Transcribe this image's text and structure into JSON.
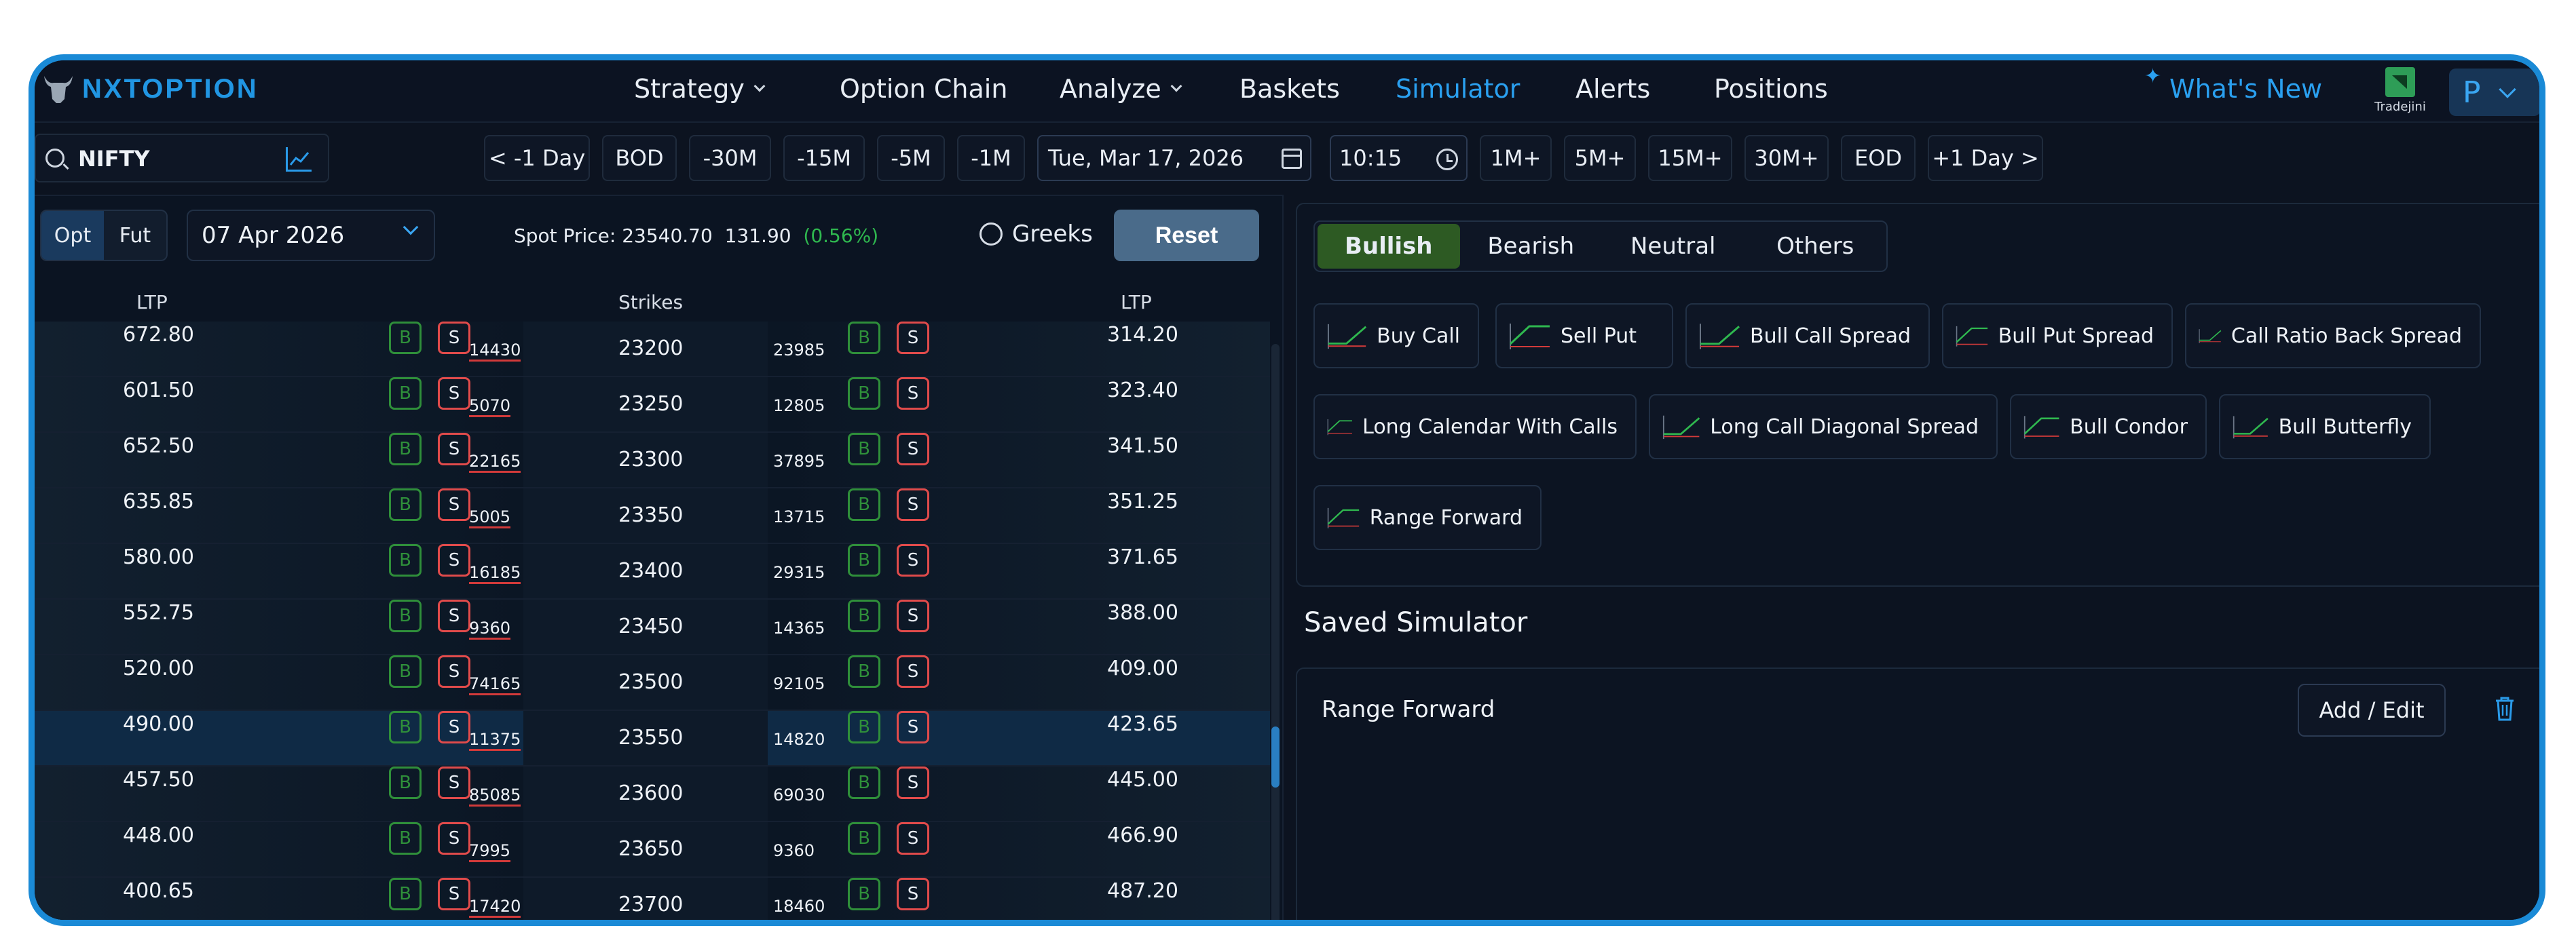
{
  "brand": "NXTOPTION",
  "nav": {
    "items": [
      {
        "label": "Strategy",
        "dropdown": true
      },
      {
        "label": "Option Chain",
        "dropdown": false
      },
      {
        "label": "Analyze",
        "dropdown": true
      },
      {
        "label": "Baskets",
        "dropdown": false
      },
      {
        "label": "Simulator",
        "dropdown": false,
        "active": true
      },
      {
        "label": "Alerts",
        "dropdown": false
      },
      {
        "label": "Positions",
        "dropdown": false
      }
    ],
    "whats_new": "What's New",
    "broker": "Tradejini",
    "profile_initial": "P"
  },
  "search": {
    "value": "NIFTY"
  },
  "toolbar": {
    "buttons": [
      "< -1 Day",
      "BOD",
      "-30M",
      "-15M",
      "-5M",
      "-1M"
    ],
    "date": "Tue, Mar 17, 2026",
    "time": "10:15",
    "buttons_after": [
      "1M+",
      "5M+",
      "15M+",
      "30M+",
      "EOD",
      "+1 Day >"
    ]
  },
  "chain": {
    "segments": [
      "Opt",
      "Fut"
    ],
    "active_segment": "Opt",
    "expiry": "07 Apr 2026",
    "spot_label": "Spot Price: 23540.70",
    "spot_change": "131.90",
    "spot_change_pct": "(0.56%)",
    "greeks_label": "Greeks",
    "reset_label": "Reset",
    "headers": {
      "ltp_left": "LTP",
      "strikes": "Strikes",
      "ltp_right": "LTP"
    },
    "buy_label": "B",
    "sell_label": "S",
    "rows": [
      {
        "call_ltp": "672.80",
        "call_oi": "14430",
        "strike": "23200",
        "put_oi": "23985",
        "put_ltp": "314.20"
      },
      {
        "call_ltp": "601.50",
        "call_oi": "5070",
        "strike": "23250",
        "put_oi": "12805",
        "put_ltp": "323.40"
      },
      {
        "call_ltp": "652.50",
        "call_oi": "22165",
        "strike": "23300",
        "put_oi": "37895",
        "put_ltp": "341.50"
      },
      {
        "call_ltp": "635.85",
        "call_oi": "5005",
        "strike": "23350",
        "put_oi": "13715",
        "put_ltp": "351.25"
      },
      {
        "call_ltp": "580.00",
        "call_oi": "16185",
        "strike": "23400",
        "put_oi": "29315",
        "put_ltp": "371.65"
      },
      {
        "call_ltp": "552.75",
        "call_oi": "9360",
        "strike": "23450",
        "put_oi": "14365",
        "put_ltp": "388.00"
      },
      {
        "call_ltp": "520.00",
        "call_oi": "74165",
        "strike": "23500",
        "put_oi": "92105",
        "put_ltp": "409.00"
      },
      {
        "call_ltp": "490.00",
        "call_oi": "11375",
        "strike": "23550",
        "put_oi": "14820",
        "put_ltp": "423.65",
        "atm": true
      },
      {
        "call_ltp": "457.50",
        "call_oi": "85085",
        "strike": "23600",
        "put_oi": "69030",
        "put_ltp": "445.00"
      },
      {
        "call_ltp": "448.00",
        "call_oi": "7995",
        "strike": "23650",
        "put_oi": "9360",
        "put_ltp": "466.90"
      },
      {
        "call_ltp": "400.65",
        "call_oi": "17420",
        "strike": "23700",
        "put_oi": "18460",
        "put_ltp": "487.20"
      }
    ]
  },
  "strategies": {
    "tabs": [
      "Bullish",
      "Bearish",
      "Neutral",
      "Others"
    ],
    "active_tab": "Bullish",
    "items": [
      "Buy Call",
      "Sell Put",
      "Bull Call Spread",
      "Bull Put Spread",
      "Call Ratio Back Spread",
      "Long Calendar With Calls",
      "Long Call Diagonal Spread",
      "Bull Condor",
      "Bull Butterfly",
      "Range Forward"
    ]
  },
  "saved": {
    "title": "Saved Simulator",
    "name": "Range Forward",
    "add_edit_label": "Add / Edit"
  },
  "colors": {
    "accent": "#2196e3",
    "buy": "#2f8f3a",
    "sell": "#e14b4b",
    "bullish_tab": "#2d5a23",
    "positive": "#2fb84f"
  }
}
